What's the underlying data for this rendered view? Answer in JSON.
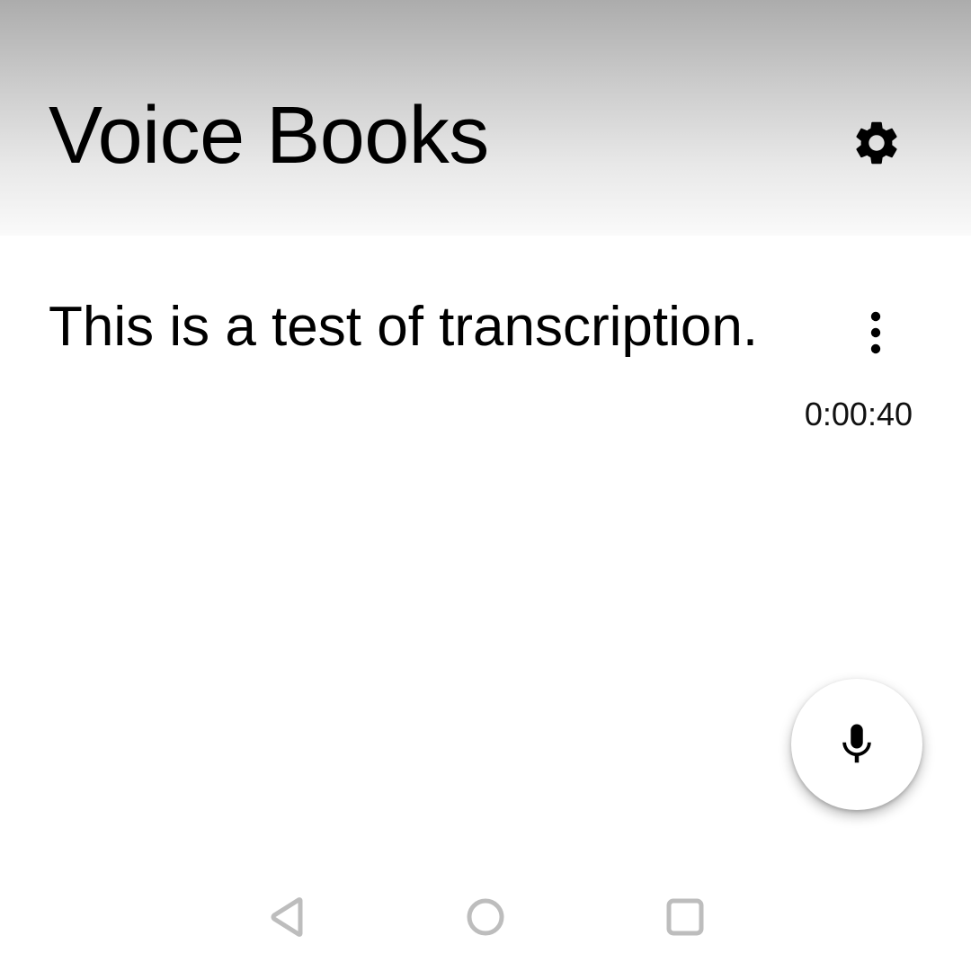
{
  "header": {
    "title": "Voice Books",
    "settings_icon": "gear-icon"
  },
  "recordings": [
    {
      "text": "This is a test of transcription.",
      "duration": "0:00:40",
      "menu_icon": "more-vert-icon"
    }
  ],
  "fab": {
    "icon": "microphone-icon"
  },
  "navigation": {
    "back_icon": "back-triangle-icon",
    "home_icon": "home-circle-icon",
    "recents_icon": "recents-square-icon"
  },
  "colors": {
    "header_gradient_top": "#acacac",
    "header_gradient_bottom": "#fafafa",
    "background": "#ffffff",
    "text": "#000000",
    "nav_icon": "#bdbdbd"
  }
}
